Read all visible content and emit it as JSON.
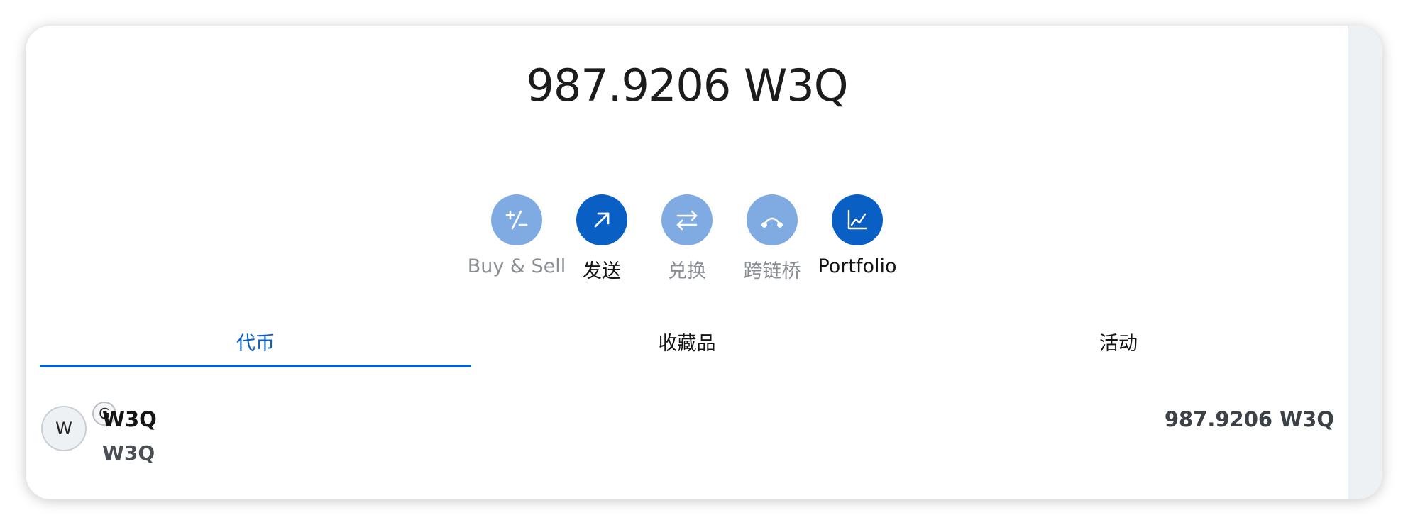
{
  "header": {
    "balance": "987.9206 W3Q"
  },
  "actions": [
    {
      "label": "Buy & Sell",
      "icon": "plus-minus-icon",
      "state": "disabled"
    },
    {
      "label": "发送",
      "icon": "arrow-up-right-icon",
      "state": "enabled"
    },
    {
      "label": "兑换",
      "icon": "swap-arrows-icon",
      "state": "disabled"
    },
    {
      "label": "跨链桥",
      "icon": "bridge-icon",
      "state": "disabled"
    },
    {
      "label": "Portfolio",
      "icon": "chart-icon",
      "state": "enabled"
    }
  ],
  "tabs": [
    {
      "label": "代币",
      "selected": true
    },
    {
      "label": "收藏品",
      "selected": false
    },
    {
      "label": "活动",
      "selected": false
    }
  ],
  "assets": [
    {
      "avatar_letter": "W",
      "badge_letter": "G",
      "name": "W3Q",
      "subtitle": "W3Q",
      "amount": "987.9206 W3Q"
    }
  ],
  "colors": {
    "accent": "#0a5fc4",
    "accent_muted": "#7fabe2"
  }
}
